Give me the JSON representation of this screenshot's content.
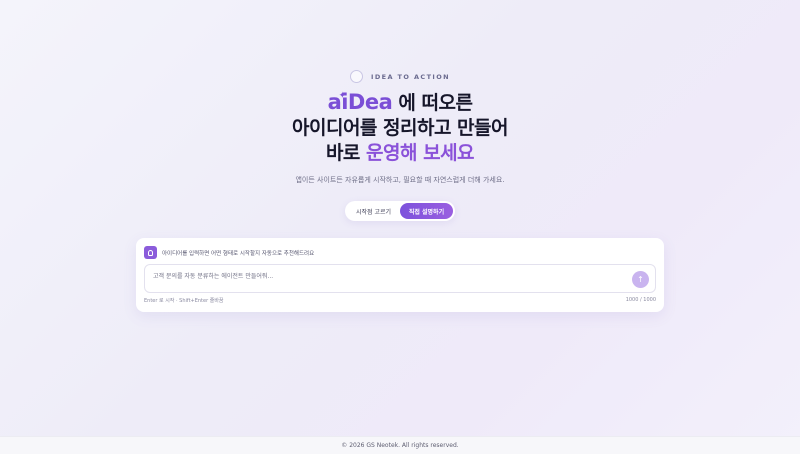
{
  "hero": {
    "eyebrow": "IDEA TO ACTION",
    "brand": "aiDea",
    "line1_rest": " 에 떠오른",
    "line2": "아이디어를 정리하고 만들어",
    "line3_plain": "바로 ",
    "line3_accent": "운영해 보세요",
    "subtitle": "앱이든 사이트든 자유롭게 시작하고, 필요할 때 자연스럽게 더해 가세요."
  },
  "toggle": {
    "option_template": "시작점 고르기",
    "option_describe": "직접 설명하기",
    "active": "option_describe"
  },
  "composer": {
    "hint": "아이디어를 입력하면 어떤 형태로 시작할지 자동으로 추천해드려요",
    "placeholder": "고객 문의를 자동 분류하는 에이전트 만들어줘...",
    "value": "",
    "shortcut_hint": "Enter 로 시작 · Shift+Enter 줄바꿈",
    "char_count": "1000 / 1000"
  },
  "footer": {
    "copyright": "© 2026 GS Neotek. All rights reserved."
  },
  "colors": {
    "accent": "#7b4fd6",
    "accent_light": "#c9b4ef"
  }
}
